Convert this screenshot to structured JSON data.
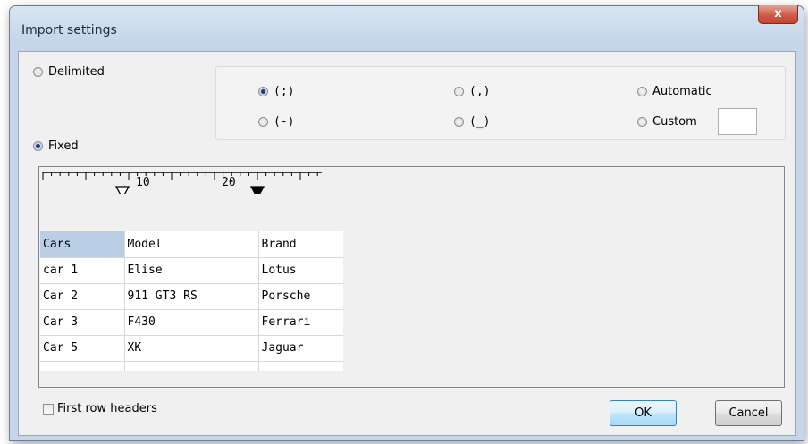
{
  "window": {
    "title": "Import settings",
    "close_glyph": "x"
  },
  "mode": {
    "delimited_label": "Delimited",
    "fixed_label": "Fixed",
    "selected": "fixed"
  },
  "separators": {
    "semicolon": "(;)",
    "comma": "(,)",
    "automatic": "Automatic",
    "dash": "(-)",
    "underscore": "(_)",
    "custom": "Custom",
    "custom_value": "",
    "selected": "semicolon"
  },
  "ruler": {
    "label_10": "10",
    "label_20": "20"
  },
  "preview": {
    "rows": [
      [
        "Cars",
        "Model",
        "Brand"
      ],
      [
        "car 1",
        "Elise",
        "Lotus"
      ],
      [
        "Car 2",
        "911 GT3 RS",
        "Porsche"
      ],
      [
        "Car 3",
        "F430",
        "Ferrari"
      ],
      [
        "Car 5",
        "XK",
        "Jaguar"
      ]
    ],
    "selected_cell": "Cars"
  },
  "first_row_headers": {
    "label": "First row headers",
    "checked": false
  },
  "buttons": {
    "ok": "OK",
    "cancel": "Cancel"
  }
}
